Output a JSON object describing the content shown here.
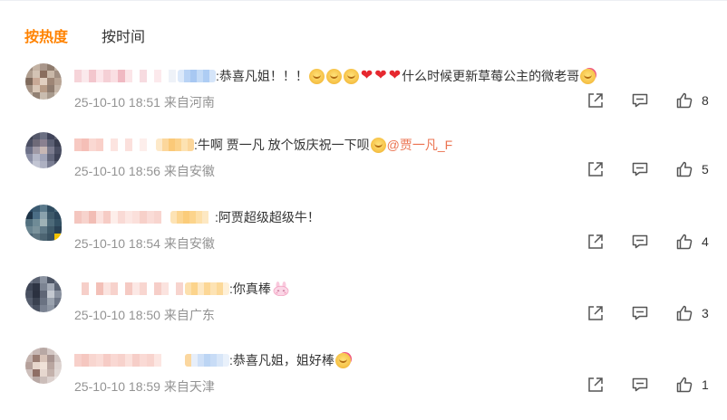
{
  "tabs": {
    "hot": "按热度",
    "time": "按时间"
  },
  "colors": {
    "accent": "#ff8200",
    "mention": "#eb7350",
    "meta": "#939393"
  },
  "comments": [
    {
      "text": ":恭喜凡姐！！！",
      "text2": "什么时候更新草莓公主的微老哥",
      "time": "25-10-10 18:51 来自河南",
      "likes": "8",
      "icons": [
        "face-emoji-icon",
        "heart-icon",
        "party-emoji-icon"
      ]
    },
    {
      "text": ":牛啊 贾一凡 放个饭庆祝一下呗",
      "mention": "@贾一凡_F",
      "time": "25-10-10 18:56 来自安徽",
      "likes": "5"
    },
    {
      "text": ":阿贾超级超级牛！",
      "time": "25-10-10 18:54 来自安徽",
      "likes": "4"
    },
    {
      "text": ":你真棒",
      "time": "25-10-10 18:50 来自广东",
      "likes": "3",
      "icons": [
        "bunny-emoji-icon"
      ]
    },
    {
      "text": ":恭喜凡姐，姐好棒",
      "time": "25-10-10 18:59 来自天津",
      "likes": "1",
      "icons": [
        "party-emoji-icon"
      ]
    }
  ]
}
